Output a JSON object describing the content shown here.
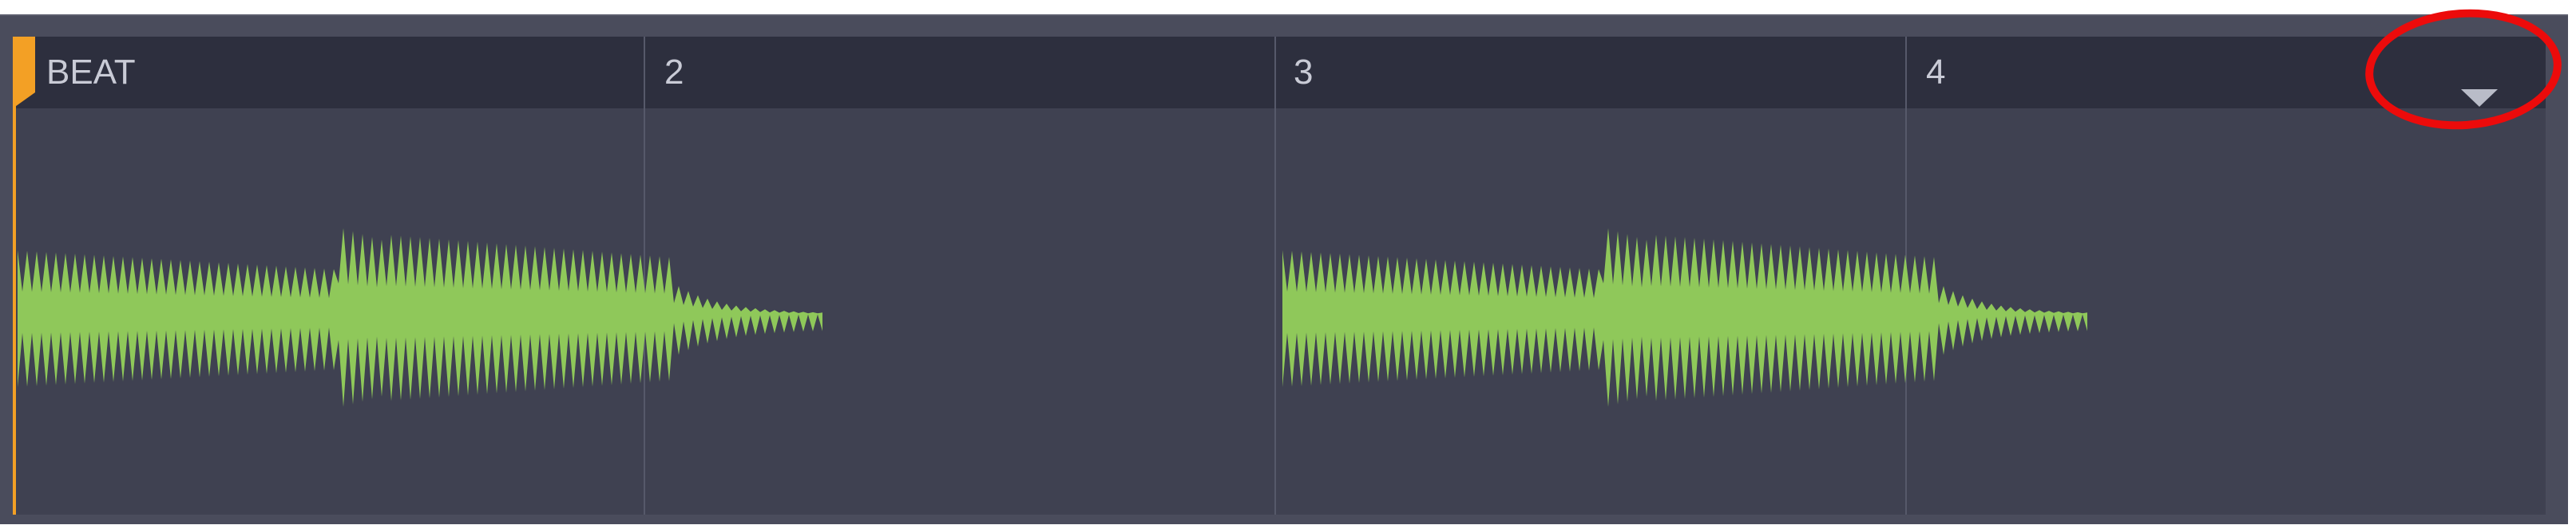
{
  "ruler": {
    "beats": [
      "BEAT",
      "2",
      "3",
      "4"
    ]
  },
  "colors": {
    "waveform": "#8fc85a",
    "playhead": "#f3a025",
    "annotation": "#ec0b0b"
  },
  "icons": {
    "dropdown": "triangle-down-icon"
  }
}
